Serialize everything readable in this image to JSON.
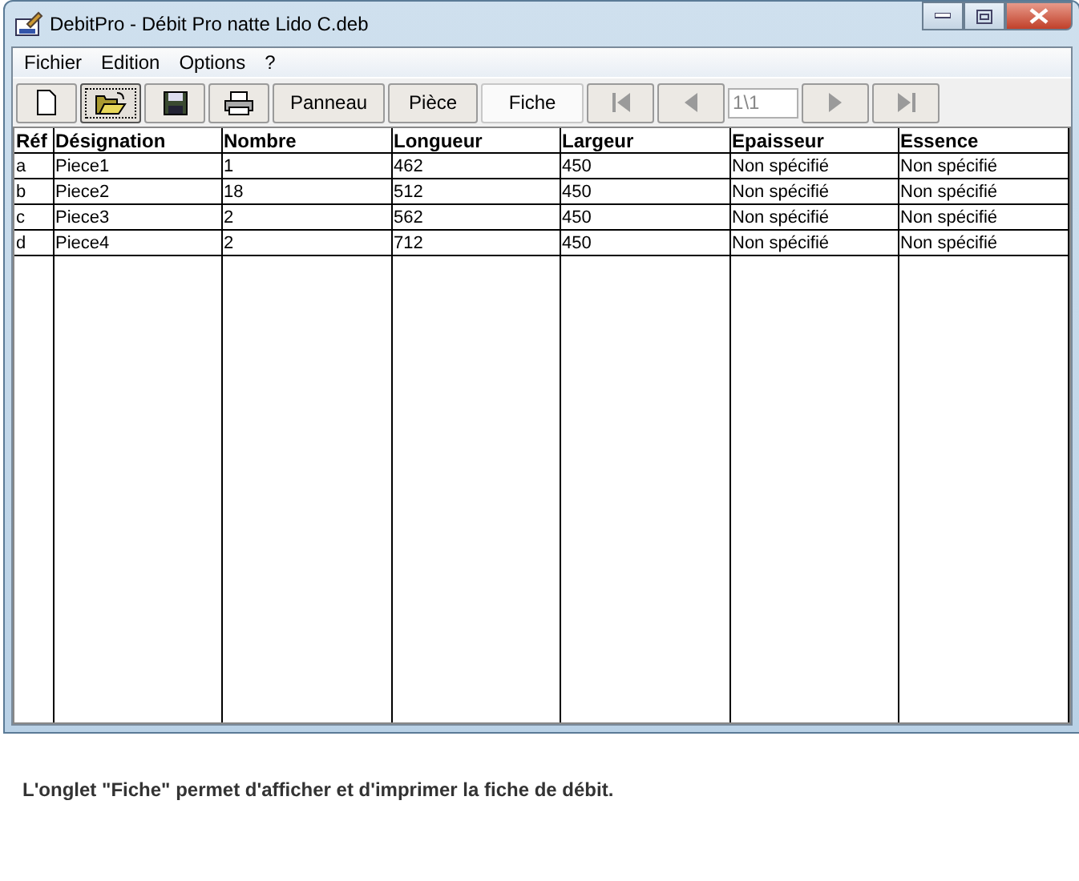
{
  "window": {
    "title": "DebitPro - Débit Pro natte Lido C.deb"
  },
  "menu": [
    "Fichier",
    "Edition",
    "Options",
    "?"
  ],
  "toolbar": [
    {
      "kind": "new",
      "selected": false
    },
    {
      "kind": "open",
      "selected": true
    },
    {
      "kind": "save",
      "selected": false
    },
    {
      "kind": "print",
      "selected": false
    }
  ],
  "tabs": [
    {
      "label": "Panneau",
      "selected": false
    },
    {
      "label": "Pièce",
      "selected": false
    },
    {
      "label": "Fiche",
      "selected": true
    }
  ],
  "navigation": [
    {
      "kind": "first",
      "disabled": true
    },
    {
      "kind": "prev",
      "disabled": true
    },
    {
      "kind": "page",
      "value": "1\\1"
    },
    {
      "kind": "next",
      "disabled": true
    },
    {
      "kind": "last",
      "disabled": true
    }
  ],
  "table": {
    "columns": [
      "Réf",
      "Désignation",
      "Nombre",
      "Longueur",
      "Largeur",
      "Epaisseur",
      "Essence"
    ],
    "rows": [
      [
        "a",
        "Piece1",
        "1",
        "462",
        "450",
        "Non spécifié",
        "Non spécifié"
      ],
      [
        "b",
        "Piece2",
        "18",
        "512",
        "450",
        "Non spécifié",
        "Non spécifié"
      ],
      [
        "c",
        "Piece3",
        "2",
        "562",
        "450",
        "Non spécifié",
        "Non spécifié"
      ],
      [
        "d",
        "Piece4",
        "2",
        "712",
        "450",
        "Non spécifié",
        "Non spécifié"
      ]
    ]
  },
  "caption": "L'onglet \"Fiche\" permet d'afficher et d'imprimer la fiche de débit."
}
